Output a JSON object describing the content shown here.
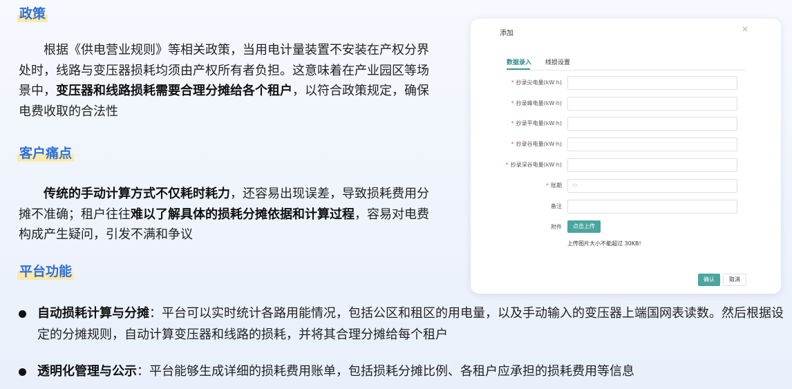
{
  "sections": {
    "policy": {
      "heading": "政策",
      "p1": "根据《供电营业规则》等相关政策，当用电计量装置不安装在产权分界处时，线路与变压器损耗均须由产权所有者负担。这意味着在产业园区等场景中，",
      "bold": "变压器和线路损耗需要合理分摊给各个租户",
      "p2": "，以符合政策规定，确保电费收取的合法性"
    },
    "pain": {
      "heading": "客户痛点",
      "bold1": "传统的手动计算方式不仅耗时耗力",
      "t1": "，还容易出现误差，导致损耗费用分摊不准确；租户往往",
      "bold2": "难以了解具体的损耗分摊依据和计算过程",
      "t2": "，容易对电费构成产生疑问，引发不满和争议"
    },
    "features": {
      "heading": "平台功能",
      "items": [
        {
          "title": "自动损耗计算与分摊",
          "text": "：平台可以实时统计各路用能情况，包括公区和租区的用电量，以及手动输入的变压器上端国网表读数。然后根据设定的分摊规则，自动计算变压器和线路的损耗，并将其合理分摊给每个租户"
        },
        {
          "title": "透明化管理与公示",
          "text": "：平台能够生成详细的损耗费用账单，包括损耗分摊比例、各租户应承担的损耗费用等信息"
        }
      ]
    }
  },
  "dialog": {
    "title": "添加",
    "close": "×",
    "tabs": [
      {
        "label": "数据录入",
        "active": true
      },
      {
        "label": "线损设置",
        "active": false
      }
    ],
    "fields": [
      {
        "label": "抄录尖电量(kW·h)",
        "required": true
      },
      {
        "label": "抄录峰电量(kW·h)",
        "required": true
      },
      {
        "label": "抄录平电量(kW·h)",
        "required": true
      },
      {
        "label": "抄录谷电量(kW·h)",
        "required": true
      },
      {
        "label": "抄录深谷电量(kW·h)",
        "required": true
      },
      {
        "label": "账期",
        "required": true
      },
      {
        "label": "备注",
        "required": false
      }
    ],
    "required_mark": "*",
    "calendar_icon": "▭",
    "attachment_label": "附件",
    "upload_button": "点击上传",
    "upload_hint": "上传图片大小不能超过 30KB!",
    "ok_button": "确认",
    "cancel_button": "取消"
  }
}
